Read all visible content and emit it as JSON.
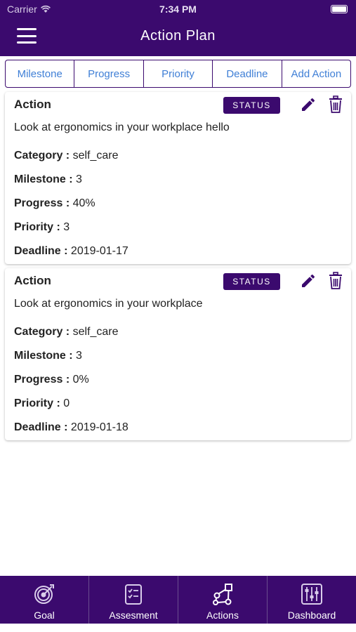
{
  "status_bar": {
    "carrier": "Carrier",
    "time": "7:34 PM"
  },
  "header": {
    "title": "Action Plan",
    "menu_icon": "hamburger-menu-icon"
  },
  "tabs": [
    {
      "label": "Milestone"
    },
    {
      "label": "Progress"
    },
    {
      "label": "Priority"
    },
    {
      "label": "Deadline"
    },
    {
      "label": "Add Action"
    }
  ],
  "actions": [
    {
      "title": "Action",
      "status_label": "STATUS",
      "description": "Look at ergonomics in your workplace hello",
      "category_label": "Category :",
      "category": "self_care",
      "milestone_label": "Milestone :",
      "milestone": "3",
      "progress_label": "Progress :",
      "progress": "40%",
      "priority_label": "Priority :",
      "priority": "3",
      "deadline_label": "Deadline :",
      "deadline": "2019-01-17"
    },
    {
      "title": "Action",
      "status_label": "STATUS",
      "description": "Look at ergonomics in your workplace",
      "category_label": "Category :",
      "category": "self_care",
      "milestone_label": "Milestone :",
      "milestone": "3",
      "progress_label": "Progress :",
      "progress": "0%",
      "priority_label": "Priority :",
      "priority": "0",
      "deadline_label": "Deadline :",
      "deadline": "2019-01-18"
    }
  ],
  "bottom_nav": [
    {
      "label": "Goal",
      "icon": "target-icon"
    },
    {
      "label": "Assesment",
      "icon": "checklist-icon"
    },
    {
      "label": "Actions",
      "icon": "flow-nodes-icon"
    },
    {
      "label": "Dashboard",
      "icon": "sliders-icon"
    }
  ],
  "colors": {
    "primary": "#3b0a6e",
    "tab_text": "#3f7fd6"
  }
}
